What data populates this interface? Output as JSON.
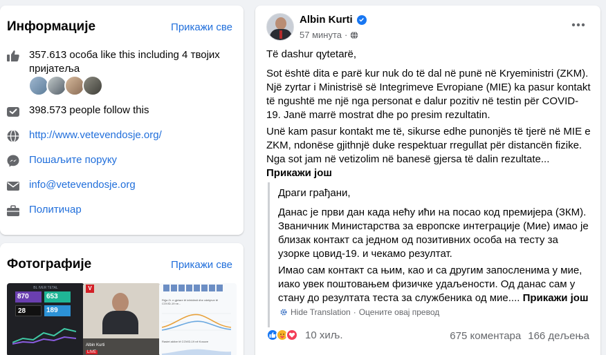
{
  "info": {
    "title": "Информације",
    "see_all": "Прикажи све",
    "likes_line1": "357.613 особа like this including 4 твојих",
    "likes_line2": "пријатеља",
    "follow": "398.573 people follow this",
    "website": "http://www.vetevendosje.org/",
    "message": "Пошаљите поруку",
    "email": "info@vetevendosje.org",
    "category": "Политичар"
  },
  "photos": {
    "title": "Фотографије",
    "see_all": "Прикажи све",
    "photo1": {
      "header": "BL IVER TETAL",
      "numbers": [
        "870",
        "653",
        "28",
        "189"
      ]
    },
    "photo2": {
      "caption": "Albin Kurti",
      "badge": "V",
      "live": "LIVE"
    },
    "photo3": {
      "header": "Rrjja Zr. e gjetare të infektimit dhe vdekjeve të COVID-19 ne...",
      "footer": "Rastet aktive të COVID-19 në Kosove"
    }
  },
  "post": {
    "author": "Albin Kurti",
    "time": "57 минута",
    "greeting": "Të dashur qytetarë,",
    "p1": "Sot është dita e parë kur nuk do të dal në punë në Kryeministri (ZKM). Një zyrtar i Ministrisë së Integrimeve Evropiane (MIE) ka pasur kontakt të ngushtë me një nga personat e dalur pozitiv në testin për COVID-19. Janë marrë mostrat dhe po presim rezultatin.",
    "p2": "Unë kam pasur kontakt me të, sikurse edhe punonjës të tjerë në MIE e ZKM, ndonëse gjithnjë duke respektuar rregullat për distancën fizike. Nga sot jam në vetizolim në banesë gjersa të dalin rezultate...",
    "see_more": "Прикажи још",
    "translation": {
      "greeting": "Драги грађани,",
      "p1": "Данас је први дан када нећу ићи на посао код премијера (ЗКМ). Званичник Министарства за европске интеграције (Мие) имао је близак контакт са једном од позитивних особа на тесту за узорке цовид-19. и чекамо резултат.",
      "p2": "Имао сам контакт са њим, као и са другим запосленима у мие, иако увек поштовањем физичке удаљености. Од данас сам у стану до резултата теста за службеника од мие....",
      "see_more": "Прикажи још",
      "hide": "Hide Translation",
      "separator": "·",
      "rate": "Оцените овај превод"
    },
    "reactions_count": "10 хиљ.",
    "comments": "675 коментара",
    "shares": "166 дељења"
  },
  "colors": {
    "link": "#216fdb",
    "like_blue": "#1877f2",
    "love_red": "#f33e58",
    "haha_yellow": "#f7b125",
    "muted": "#65676b",
    "background": "#f0f2f5"
  },
  "icons": {
    "likes": "thumbs-up-icon",
    "follow": "follow-box-icon",
    "website": "globe-icon",
    "message": "messenger-icon",
    "email": "envelope-icon",
    "category": "briefcase-icon"
  }
}
